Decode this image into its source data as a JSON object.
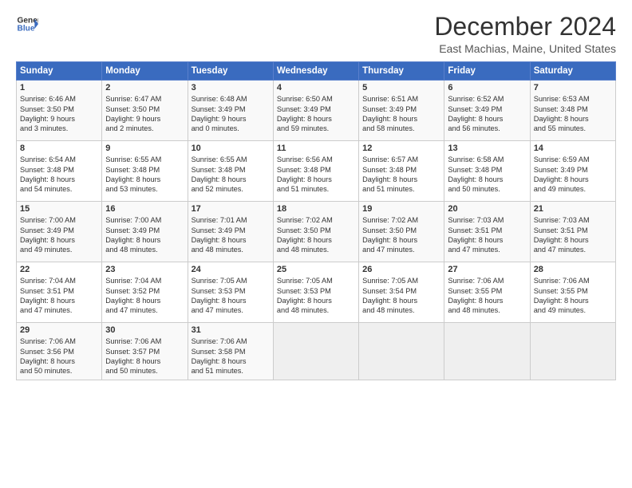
{
  "header": {
    "logo_line1": "General",
    "logo_line2": "Blue",
    "month": "December 2024",
    "location": "East Machias, Maine, United States"
  },
  "days_of_week": [
    "Sunday",
    "Monday",
    "Tuesday",
    "Wednesday",
    "Thursday",
    "Friday",
    "Saturday"
  ],
  "weeks": [
    [
      {
        "day": 1,
        "lines": [
          "Sunrise: 6:46 AM",
          "Sunset: 3:50 PM",
          "Daylight: 9 hours",
          "and 3 minutes."
        ]
      },
      {
        "day": 2,
        "lines": [
          "Sunrise: 6:47 AM",
          "Sunset: 3:50 PM",
          "Daylight: 9 hours",
          "and 2 minutes."
        ]
      },
      {
        "day": 3,
        "lines": [
          "Sunrise: 6:48 AM",
          "Sunset: 3:49 PM",
          "Daylight: 9 hours",
          "and 0 minutes."
        ]
      },
      {
        "day": 4,
        "lines": [
          "Sunrise: 6:50 AM",
          "Sunset: 3:49 PM",
          "Daylight: 8 hours",
          "and 59 minutes."
        ]
      },
      {
        "day": 5,
        "lines": [
          "Sunrise: 6:51 AM",
          "Sunset: 3:49 PM",
          "Daylight: 8 hours",
          "and 58 minutes."
        ]
      },
      {
        "day": 6,
        "lines": [
          "Sunrise: 6:52 AM",
          "Sunset: 3:49 PM",
          "Daylight: 8 hours",
          "and 56 minutes."
        ]
      },
      {
        "day": 7,
        "lines": [
          "Sunrise: 6:53 AM",
          "Sunset: 3:48 PM",
          "Daylight: 8 hours",
          "and 55 minutes."
        ]
      }
    ],
    [
      {
        "day": 8,
        "lines": [
          "Sunrise: 6:54 AM",
          "Sunset: 3:48 PM",
          "Daylight: 8 hours",
          "and 54 minutes."
        ]
      },
      {
        "day": 9,
        "lines": [
          "Sunrise: 6:55 AM",
          "Sunset: 3:48 PM",
          "Daylight: 8 hours",
          "and 53 minutes."
        ]
      },
      {
        "day": 10,
        "lines": [
          "Sunrise: 6:55 AM",
          "Sunset: 3:48 PM",
          "Daylight: 8 hours",
          "and 52 minutes."
        ]
      },
      {
        "day": 11,
        "lines": [
          "Sunrise: 6:56 AM",
          "Sunset: 3:48 PM",
          "Daylight: 8 hours",
          "and 51 minutes."
        ]
      },
      {
        "day": 12,
        "lines": [
          "Sunrise: 6:57 AM",
          "Sunset: 3:48 PM",
          "Daylight: 8 hours",
          "and 51 minutes."
        ]
      },
      {
        "day": 13,
        "lines": [
          "Sunrise: 6:58 AM",
          "Sunset: 3:48 PM",
          "Daylight: 8 hours",
          "and 50 minutes."
        ]
      },
      {
        "day": 14,
        "lines": [
          "Sunrise: 6:59 AM",
          "Sunset: 3:49 PM",
          "Daylight: 8 hours",
          "and 49 minutes."
        ]
      }
    ],
    [
      {
        "day": 15,
        "lines": [
          "Sunrise: 7:00 AM",
          "Sunset: 3:49 PM",
          "Daylight: 8 hours",
          "and 49 minutes."
        ]
      },
      {
        "day": 16,
        "lines": [
          "Sunrise: 7:00 AM",
          "Sunset: 3:49 PM",
          "Daylight: 8 hours",
          "and 48 minutes."
        ]
      },
      {
        "day": 17,
        "lines": [
          "Sunrise: 7:01 AM",
          "Sunset: 3:49 PM",
          "Daylight: 8 hours",
          "and 48 minutes."
        ]
      },
      {
        "day": 18,
        "lines": [
          "Sunrise: 7:02 AM",
          "Sunset: 3:50 PM",
          "Daylight: 8 hours",
          "and 48 minutes."
        ]
      },
      {
        "day": 19,
        "lines": [
          "Sunrise: 7:02 AM",
          "Sunset: 3:50 PM",
          "Daylight: 8 hours",
          "and 47 minutes."
        ]
      },
      {
        "day": 20,
        "lines": [
          "Sunrise: 7:03 AM",
          "Sunset: 3:51 PM",
          "Daylight: 8 hours",
          "and 47 minutes."
        ]
      },
      {
        "day": 21,
        "lines": [
          "Sunrise: 7:03 AM",
          "Sunset: 3:51 PM",
          "Daylight: 8 hours",
          "and 47 minutes."
        ]
      }
    ],
    [
      {
        "day": 22,
        "lines": [
          "Sunrise: 7:04 AM",
          "Sunset: 3:51 PM",
          "Daylight: 8 hours",
          "and 47 minutes."
        ]
      },
      {
        "day": 23,
        "lines": [
          "Sunrise: 7:04 AM",
          "Sunset: 3:52 PM",
          "Daylight: 8 hours",
          "and 47 minutes."
        ]
      },
      {
        "day": 24,
        "lines": [
          "Sunrise: 7:05 AM",
          "Sunset: 3:53 PM",
          "Daylight: 8 hours",
          "and 47 minutes."
        ]
      },
      {
        "day": 25,
        "lines": [
          "Sunrise: 7:05 AM",
          "Sunset: 3:53 PM",
          "Daylight: 8 hours",
          "and 48 minutes."
        ]
      },
      {
        "day": 26,
        "lines": [
          "Sunrise: 7:05 AM",
          "Sunset: 3:54 PM",
          "Daylight: 8 hours",
          "and 48 minutes."
        ]
      },
      {
        "day": 27,
        "lines": [
          "Sunrise: 7:06 AM",
          "Sunset: 3:55 PM",
          "Daylight: 8 hours",
          "and 48 minutes."
        ]
      },
      {
        "day": 28,
        "lines": [
          "Sunrise: 7:06 AM",
          "Sunset: 3:55 PM",
          "Daylight: 8 hours",
          "and 49 minutes."
        ]
      }
    ],
    [
      {
        "day": 29,
        "lines": [
          "Sunrise: 7:06 AM",
          "Sunset: 3:56 PM",
          "Daylight: 8 hours",
          "and 50 minutes."
        ]
      },
      {
        "day": 30,
        "lines": [
          "Sunrise: 7:06 AM",
          "Sunset: 3:57 PM",
          "Daylight: 8 hours",
          "and 50 minutes."
        ]
      },
      {
        "day": 31,
        "lines": [
          "Sunrise: 7:06 AM",
          "Sunset: 3:58 PM",
          "Daylight: 8 hours",
          "and 51 minutes."
        ]
      },
      null,
      null,
      null,
      null
    ]
  ]
}
